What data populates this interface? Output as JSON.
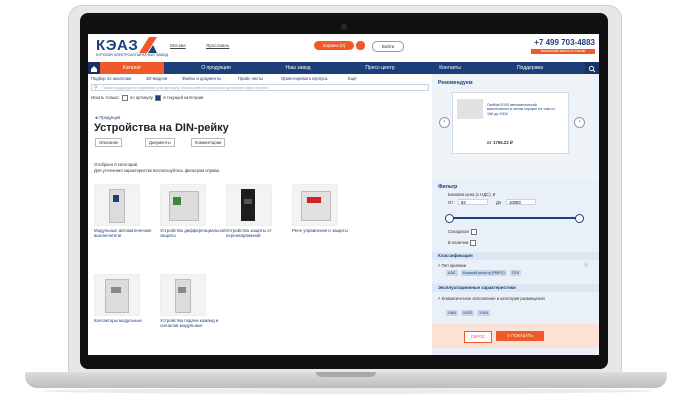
{
  "header": {
    "logo_text": "КЭАЗ",
    "logo_sub": "КУРСКИЙ ЭЛЕКТРОАППАРАТНЫЙ ЗАВОД",
    "city": "Москва",
    "city_link": "Ярославль",
    "cart_label": "Корзина (0)",
    "login_label": "Войти",
    "phone": "+7 499 703-4883",
    "callback_label": "Бесплатный звонок по России"
  },
  "nav": {
    "items": [
      "Каталог",
      "О продукции",
      "Наш завод",
      "Пресс-центр",
      "Контакты",
      "Поддержка"
    ]
  },
  "subnav": {
    "items": [
      "Подбор по аналогам",
      "3D-модели",
      "Файлы и документы",
      "Прайс-листы",
      "Ориентировать корпуса",
      "Ещё"
    ]
  },
  "search": {
    "placeholder": "Поиск продукции по названию или артикулу. Можно ввести несколько артикулов через пробел"
  },
  "find_only": {
    "label": "Искать только:",
    "opt1": "по артикулу",
    "opt2": "в текущей категории"
  },
  "breadcrumb": "Продукция",
  "page_title": "Устройства на DIN-рейку",
  "filters": [
    "Описание",
    "Документы",
    "Комментарии"
  ],
  "info": {
    "line1": "Отобрано 6 категорий.",
    "line2": "Для уточнения характеристик воспользуйтесь фильтром справа."
  },
  "categories": [
    {
      "label": "Модульные автоматические выключатели"
    },
    {
      "label": "Устройства дифференциальной защиты"
    },
    {
      "label": "Устройства защиты от перенапряжений"
    },
    {
      "label": "Реле управления и защиты"
    },
    {
      "label": "Контакторы модульные"
    },
    {
      "label": "Устройства подачи команд и сигналов модульные"
    }
  ],
  "recommended": {
    "title": "Рекомендуем",
    "product": "OptiMat E100 автоматический выключатель в литом корпусе на токи от 16А до 100А",
    "price": "от 1765.22 ₽"
  },
  "filter": {
    "title": "Фильтр",
    "price_label": "Базовая цена (с НДС), ₽",
    "from_label": "От",
    "from_value": "83",
    "to_label": "До",
    "to_value": "10093",
    "stock": "Складская",
    "available": "В наличии",
    "classification": "Классификация",
    "type_label": "Тип приемки",
    "type_tags": [
      "АЭС",
      "Морской регистр (РМРС)",
      "ОТК"
    ],
    "operating": "Эксплуатационные характеристики",
    "climate_label": "Климатическое исполнение и категория размещения",
    "climate_tags": [
      "ОМ4",
      "УХЛ2",
      "УХЛ4"
    ],
    "reset_label": "СБРОС",
    "show_label": "ПОКАЗАТЬ"
  },
  "colors": {
    "brand_blue": "#1c3f7a",
    "accent_orange": "#f05a28"
  }
}
